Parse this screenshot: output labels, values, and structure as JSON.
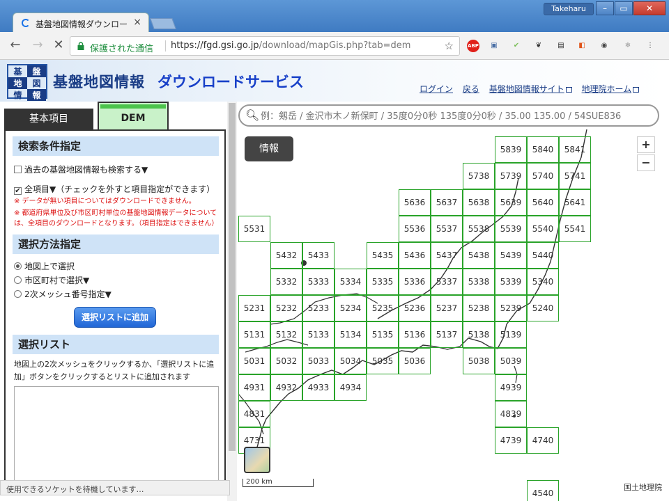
{
  "browser": {
    "user_badge": "Takeharu",
    "tab_title": "基盤地図情報ダウンロー",
    "tab_close": "×",
    "nav_back": "←",
    "nav_fwd": "→",
    "nav_reload": "✕",
    "secure_label": "保護された通信",
    "url_host": "https://fgd.gsi.go.jp",
    "url_path": "/download/mapGis.php?tab=dem",
    "star": "☆",
    "extensions": [
      {
        "name": "abp-icon",
        "label": "ABP",
        "color": "#e0201a"
      },
      {
        "name": "screen-icon",
        "label": "▣",
        "color": "#4a6fa5"
      },
      {
        "name": "check-icon",
        "label": "✔",
        "color": "#7cbf5a"
      },
      {
        "name": "evernote-icon",
        "label": "❦",
        "color": "#333333"
      },
      {
        "name": "film-icon",
        "label": "▤",
        "color": "#222222"
      },
      {
        "name": "office-icon",
        "label": "◧",
        "color": "#e0541a"
      },
      {
        "name": "color-icon",
        "label": "◉",
        "color": "#444444"
      },
      {
        "name": "snow-icon",
        "label": "❄",
        "color": "#999999"
      },
      {
        "name": "menu-icon",
        "label": "⋮",
        "color": "#555555"
      }
    ]
  },
  "header": {
    "logo": [
      "基",
      "盤",
      "地",
      "図",
      "情",
      "報"
    ],
    "title": "基盤地図情報",
    "subtitle": "ダウンロードサービス",
    "links": [
      "ログイン",
      "戻る",
      "基盤地図情報サイト",
      "地理院ホーム"
    ]
  },
  "panel": {
    "tab_basic": "基本項目",
    "tab_dem": "DEM",
    "search_title": "検索条件指定",
    "past_checkbox": "過去の基盤地図情報も検索する▼",
    "all_items": "全項目▼（チェックを外すと項目指定ができます）",
    "note1": "※ データが無い項目についてはダウンロードできません。",
    "note2": "※ 都道府県単位及び市区町村単位の基盤地図情報データについては、全項目のダウンロードとなります。（項目指定はできません）",
    "method_title": "選択方法指定",
    "radio_map": "地図上で選択",
    "radio_city": "市区町村で選択▼",
    "radio_mesh": "2次メッシュ番号指定▼",
    "add_button": "選択リストに追加",
    "list_title": "選択リスト",
    "list_help": "地図上の2次メッシュをクリックするか、「選択リストに追加」ボタンをクリックするとリストに追加されます",
    "status": "使用できるソケットを待機しています…"
  },
  "map": {
    "search_placeholder": "例：剱岳 / 金沢市木ノ新保町 / 35度0分0秒 135度0分0秒 / 35.00 135.00 / 54SUE836",
    "info_button": "情報",
    "zoom_in": "+",
    "zoom_out": "−",
    "scale": "200 km",
    "attribution": "国土地理院",
    "mesh_cells": [
      "5839",
      "5840",
      "5841",
      "5738",
      "5739",
      "5740",
      "5741",
      "5636",
      "5637",
      "5638",
      "5639",
      "5640",
      "5641",
      "5531",
      "5536",
      "5537",
      "5538",
      "5539",
      "5540",
      "5541",
      "5432",
      "5433",
      "5435",
      "5436",
      "5437",
      "5438",
      "5439",
      "5440",
      "5332",
      "5333",
      "5334",
      "5335",
      "5336",
      "5337",
      "5338",
      "5339",
      "5340",
      "5231",
      "5232",
      "5233",
      "5234",
      "5235",
      "5236",
      "5237",
      "5238",
      "5239",
      "5240",
      "5131",
      "5132",
      "5133",
      "5134",
      "5135",
      "5136",
      "5137",
      "5138",
      "5139",
      "5031",
      "5032",
      "5033",
      "5034",
      "5035",
      "5036",
      "5038",
      "5039",
      "4931",
      "4932",
      "4933",
      "4934",
      "4939",
      "4831",
      "4839",
      "4731",
      "4739",
      "4740",
      "4540"
    ]
  }
}
